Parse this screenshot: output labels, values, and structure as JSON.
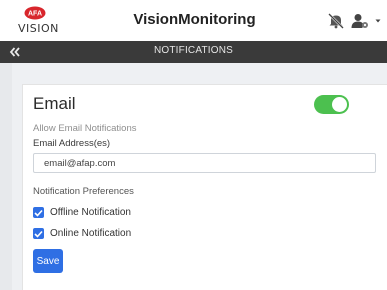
{
  "header": {
    "logo_text": "VISION",
    "logo_badge_text": "AFA",
    "title": "VisionMonitoring",
    "icons": [
      "notifications-muted-icon",
      "user-settings-icon",
      "chevron-down-icon"
    ]
  },
  "subbar": {
    "back_icon": "double-chevron-left-icon",
    "title": "NOTIFICATIONS"
  },
  "email_card": {
    "title": "Email",
    "toggle_on": true,
    "allow_label": "Allow Email Notifications",
    "address_label": "Email Address(es)",
    "address_value": "email@afap.com",
    "preferences_label": "Notification Preferences",
    "options": [
      {
        "label": "Offline Notification",
        "checked": true
      },
      {
        "label": "Online Notification",
        "checked": true
      }
    ],
    "save_label": "Save"
  },
  "colors": {
    "accent": "#2f6fe4",
    "toggle_on": "#4cc04f",
    "subbar": "#3a3a3a",
    "logo_red": "#d8262c"
  }
}
